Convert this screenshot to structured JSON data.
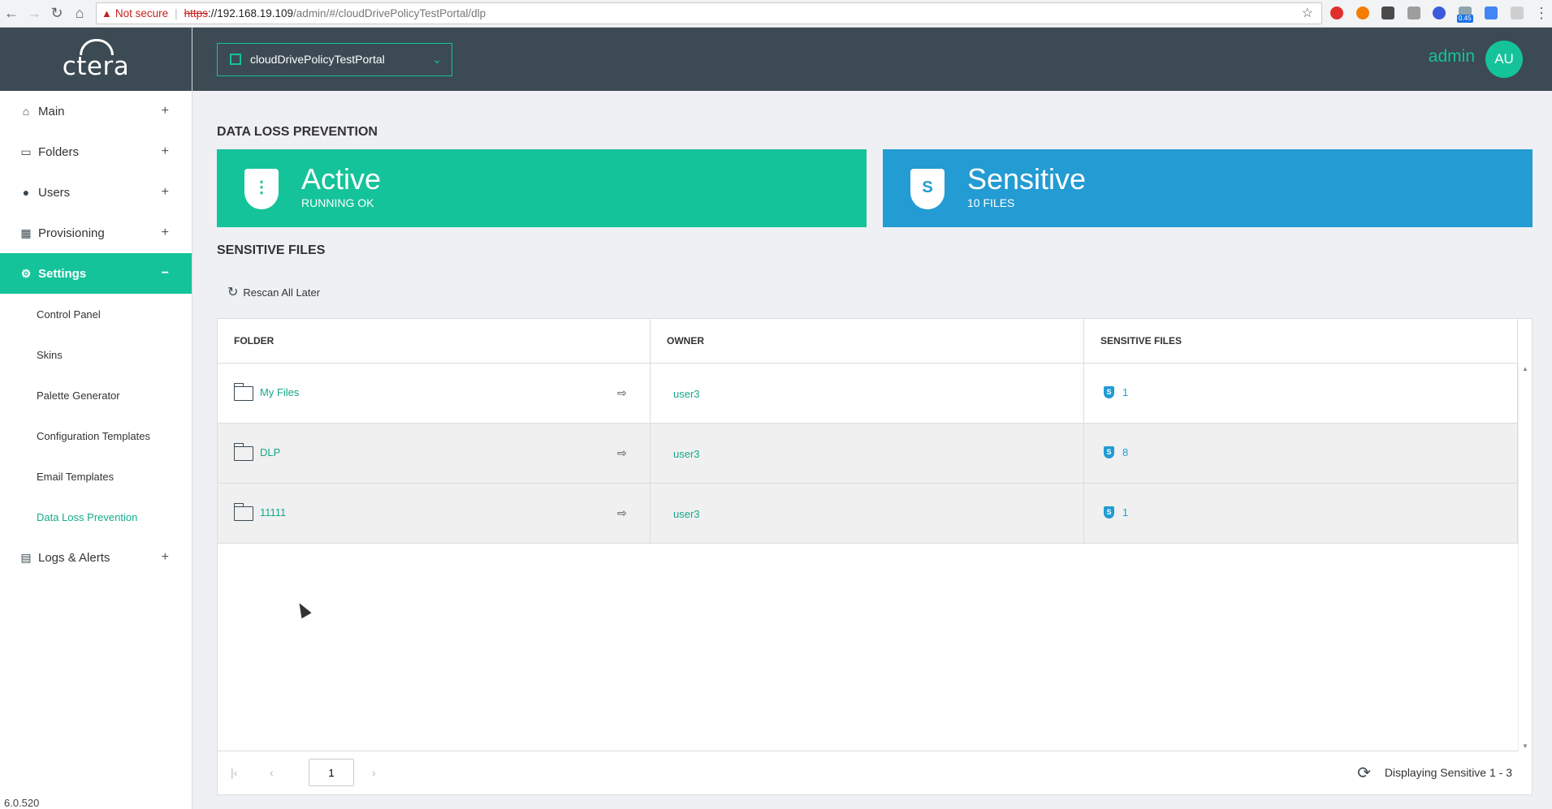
{
  "browser": {
    "not_secure_label": "Not secure",
    "url_protocol": "https",
    "url_host": "://192.168.19.109",
    "url_path": "/admin/#/cloudDrivePolicyTestPortal/dlp",
    "ext_badge": "0.45"
  },
  "sidebar": {
    "logo": "ctera",
    "items": [
      {
        "label": "Main",
        "icon": "home-icon"
      },
      {
        "label": "Folders",
        "icon": "folders-icon"
      },
      {
        "label": "Users",
        "icon": "users-icon"
      },
      {
        "label": "Provisioning",
        "icon": "grid-icon"
      },
      {
        "label": "Settings",
        "icon": "gear-icon"
      },
      {
        "label": "Logs & Alerts",
        "icon": "clipboard-icon"
      }
    ],
    "settings_sub": [
      "Control Panel",
      "Skins",
      "Palette Generator",
      "Configuration Templates",
      "Email Templates",
      "Data Loss Prevention"
    ],
    "version": "6.0.520"
  },
  "header": {
    "portal": "cloudDrivePolicyTestPortal",
    "user_name": "admin",
    "avatar_initials": "AU"
  },
  "page": {
    "title": "DATA LOSS PREVENTION",
    "status_card": {
      "big": "Active",
      "small": "RUNNING OK"
    },
    "sensitive_card": {
      "big": "Sensitive",
      "small": "10 FILES"
    },
    "files_title": "SENSITIVE FILES",
    "rescan_label": "Rescan All Later"
  },
  "table": {
    "columns": [
      "FOLDER",
      "OWNER",
      "SENSITIVE FILES"
    ],
    "rows": [
      {
        "folder": "My Files",
        "owner": "user3",
        "count": "1"
      },
      {
        "folder": "DLP",
        "owner": "user3",
        "count": "8"
      },
      {
        "folder": "11111",
        "owner": "user3",
        "count": "1"
      }
    ]
  },
  "pager": {
    "page": "1",
    "info": "Displaying Sensitive 1 - 3"
  },
  "colors": {
    "accent": "#15c39a",
    "blue": "#239bd3",
    "dark": "#3b4a53"
  }
}
